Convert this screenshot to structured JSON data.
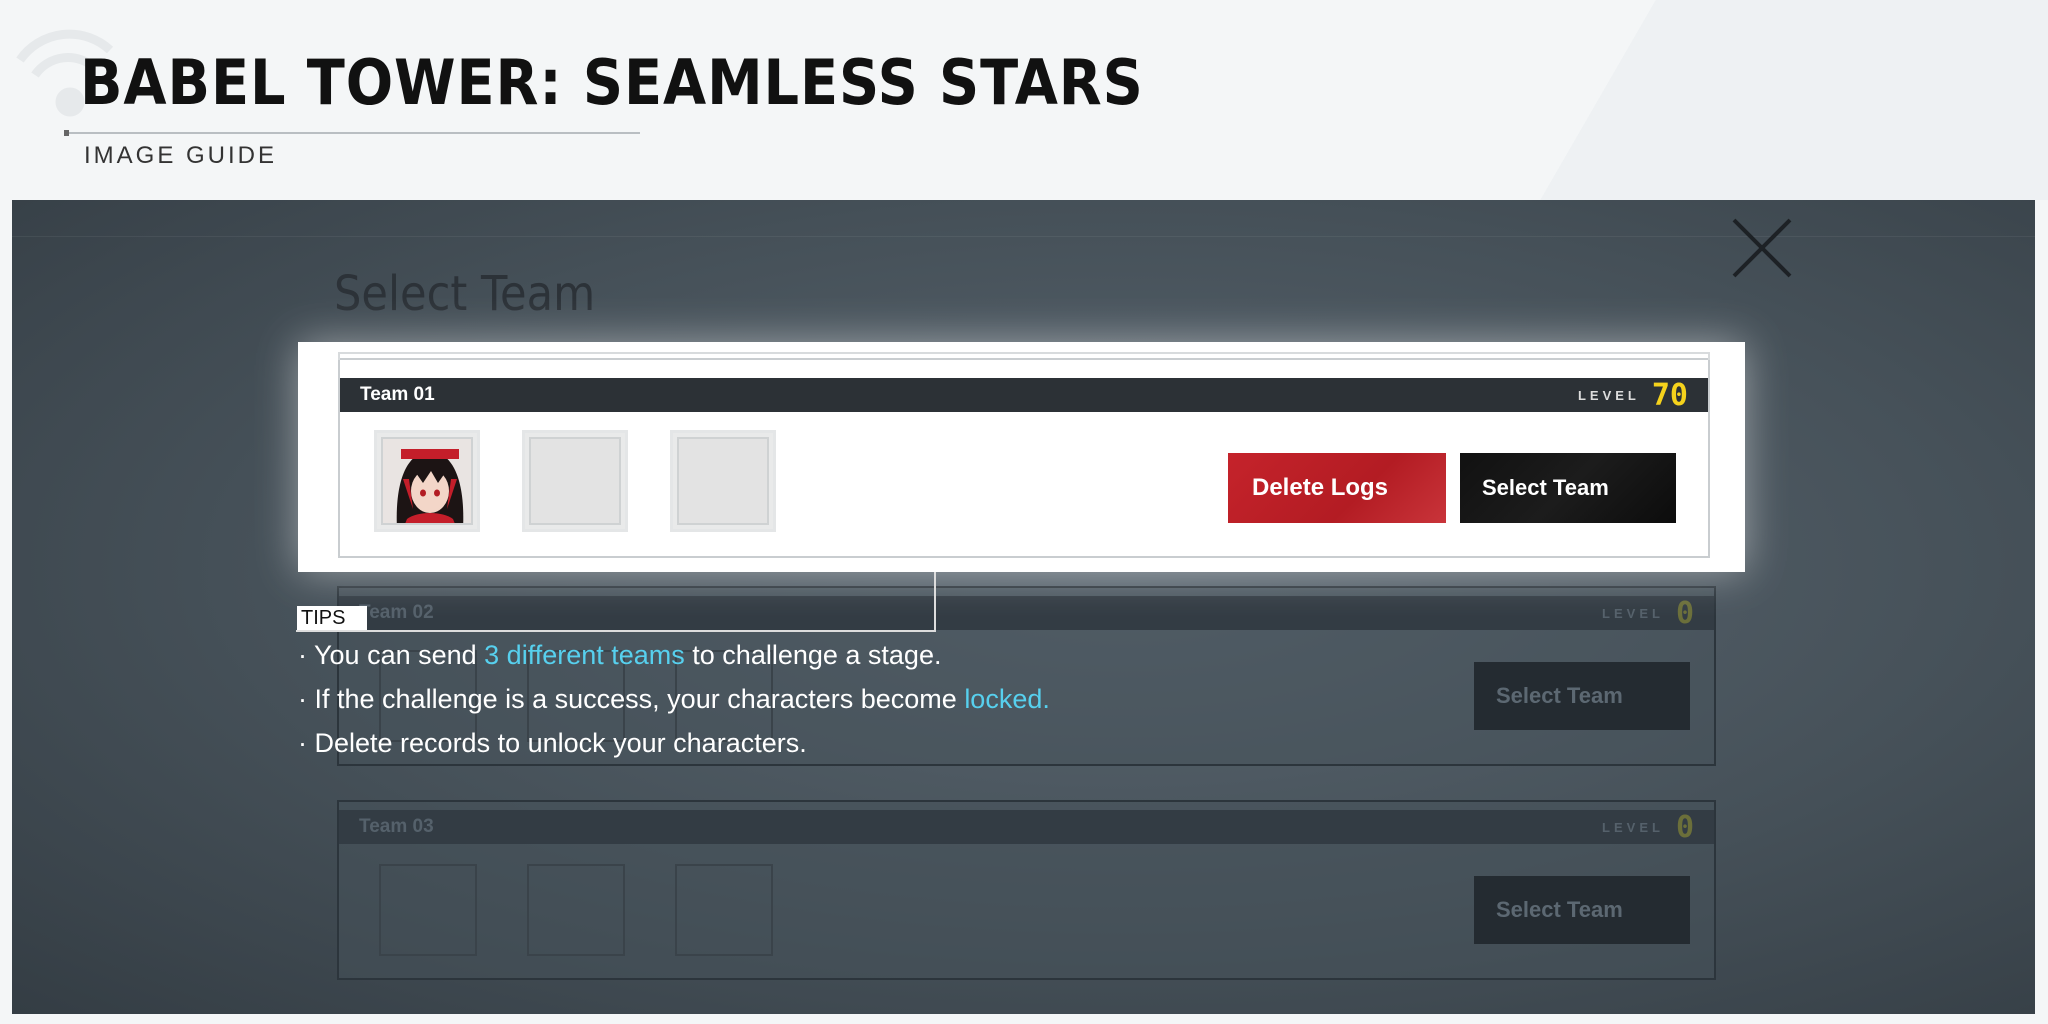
{
  "guide": {
    "title": "BABEL TOWER: SEAMLESS STARS",
    "subtitle": "IMAGE GUIDE"
  },
  "screen": {
    "title": "Select Team",
    "close_icon": "close-icon"
  },
  "teams": [
    {
      "name": "Team 01",
      "level_label": "LEVEL",
      "level": "70",
      "delete_label": "Delete Logs",
      "select_label": "Select Team"
    },
    {
      "name": "Team 02",
      "level_label": "LEVEL",
      "level": "0",
      "select_label": "Select Team"
    },
    {
      "name": "Team 03",
      "level_label": "LEVEL",
      "level": "0",
      "select_label": "Select Team"
    }
  ],
  "tips": {
    "label": "TIPS",
    "line1_pre": "· You can send ",
    "line1_hl": "3 different teams",
    "line1_post": " to challenge a stage.",
    "line2_pre": "· If the challenge is a success, your characters become ",
    "line2_hl": "locked.",
    "line3": "· Delete records to unlock your characters."
  },
  "colors": {
    "accent_yellow": "#f5d21c",
    "delete_red": "#c5232b",
    "highlight_cyan": "#57d0ee"
  }
}
